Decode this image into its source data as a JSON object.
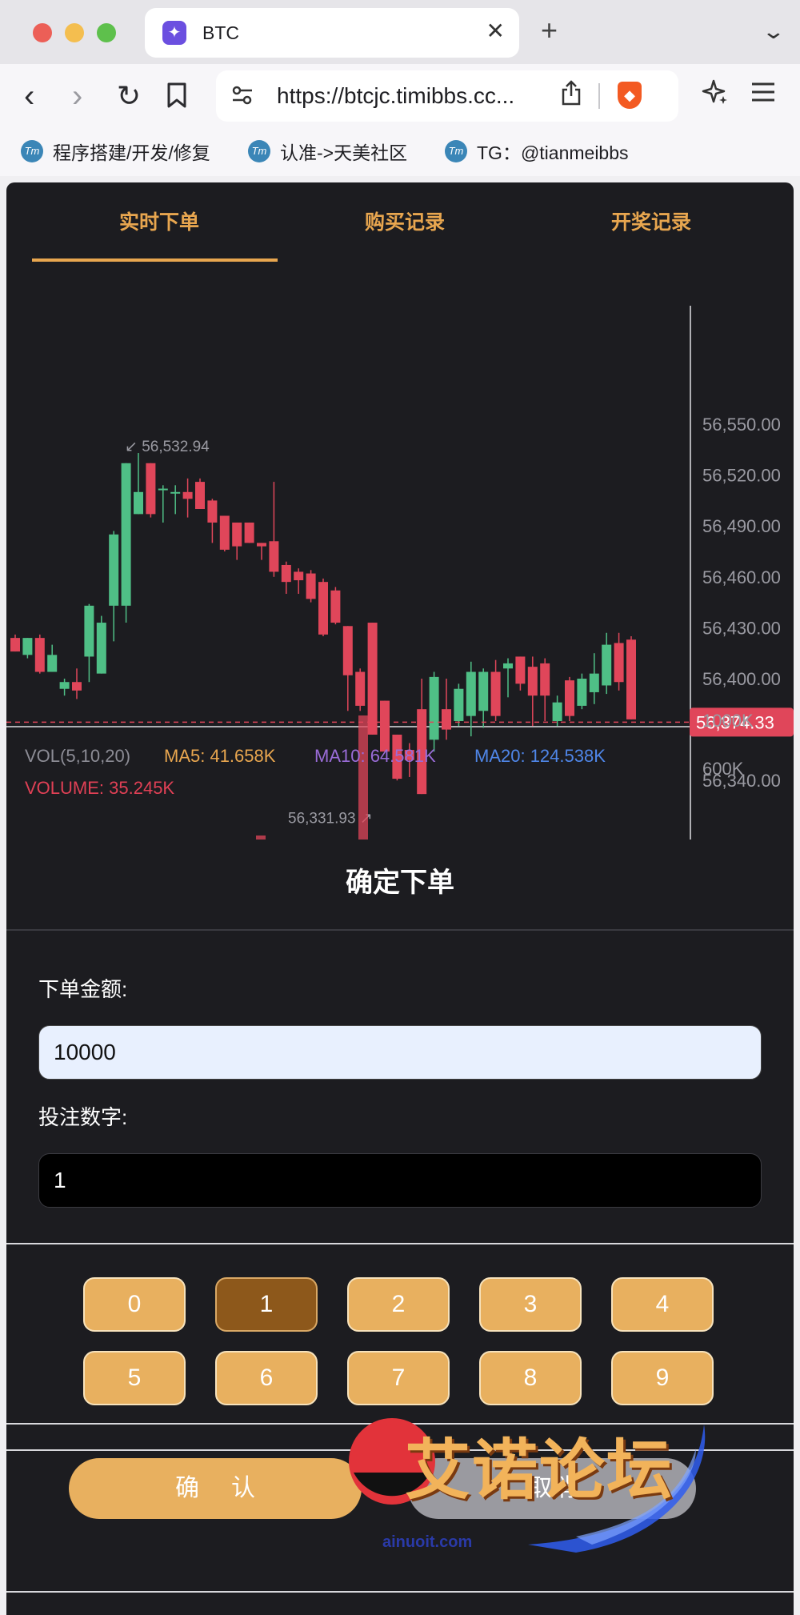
{
  "browser": {
    "tab_title": "BTC",
    "tab_close": "✕",
    "new_tab": "+",
    "tab_menu": "⌄",
    "back_icon": "‹",
    "forward_icon": "›",
    "reload_icon": "↻",
    "url": "https://btcjc.timibbs.cc...",
    "bookmarks": [
      {
        "label": "程序搭建/开发/修复",
        "icon_text": "Tm"
      },
      {
        "label": "认准->天美社区",
        "icon_text": "Tm"
      },
      {
        "label": "TG：@tianmeibbs",
        "icon_text": "Tm"
      }
    ]
  },
  "app": {
    "tabs": [
      {
        "label": "实时下单",
        "active": true
      },
      {
        "label": "购买记录",
        "active": false
      },
      {
        "label": "开奖记录",
        "active": false
      }
    ],
    "accent_color": "#e8a64f",
    "up_color": "#4fbf86",
    "down_color": "#e0465a"
  },
  "chart": {
    "price_axis": [
      "56,550.00",
      "56,520.00",
      "56,490.00",
      "56,460.00",
      "56,430.00",
      "56,400.00",
      "56,340.00"
    ],
    "current_price": "56,374.33",
    "high_label": "56,532.94",
    "low_label": "56,331.93",
    "volume_axis": [
      "1000K",
      "600K"
    ],
    "vol_legend": {
      "vol": "VOL(5,10,20)",
      "ma5": "MA5: 41.658K",
      "ma10": "MA10: 64.581K",
      "ma20": "MA20: 124.538K",
      "volume": "VOLUME: 35.245K"
    },
    "candles": [
      {
        "o": 56424,
        "h": 56426,
        "l": 56416,
        "c": 56416
      },
      {
        "o": 56414,
        "h": 56424,
        "l": 56412,
        "c": 56424
      },
      {
        "o": 56424,
        "h": 56426,
        "l": 56403,
        "c": 56404
      },
      {
        "o": 56404,
        "h": 56420,
        "l": 56404,
        "c": 56414
      },
      {
        "o": 56394,
        "h": 56400,
        "l": 56390,
        "c": 56398
      },
      {
        "o": 56398,
        "h": 56406,
        "l": 56388,
        "c": 56393
      },
      {
        "o": 56413,
        "h": 56444,
        "l": 56398,
        "c": 56443
      },
      {
        "o": 56403,
        "h": 56437,
        "l": 56403,
        "c": 56433
      },
      {
        "o": 56443,
        "h": 56487,
        "l": 56422,
        "c": 56485
      },
      {
        "o": 56443,
        "h": 56511,
        "l": 56433,
        "c": 56527
      },
      {
        "o": 56497,
        "h": 56533,
        "l": 56497,
        "c": 56510
      },
      {
        "o": 56527,
        "h": 56527,
        "l": 56495,
        "c": 56497
      },
      {
        "o": 56512,
        "h": 56514,
        "l": 56492,
        "c": 56512
      },
      {
        "o": 56510,
        "h": 56514,
        "l": 56497,
        "c": 56510
      },
      {
        "o": 56510,
        "h": 56518,
        "l": 56495,
        "c": 56506
      },
      {
        "o": 56516,
        "h": 56518,
        "l": 56500,
        "c": 56500
      },
      {
        "o": 56505,
        "h": 56506,
        "l": 56480,
        "c": 56492
      },
      {
        "o": 56496,
        "h": 56496,
        "l": 56475,
        "c": 56476
      },
      {
        "o": 56492,
        "h": 56492,
        "l": 56470,
        "c": 56478
      },
      {
        "o": 56492,
        "h": 56492,
        "l": 56480,
        "c": 56480
      },
      {
        "o": 56480,
        "h": 56480,
        "l": 56470,
        "c": 56478
      },
      {
        "o": 56481,
        "h": 56516,
        "l": 56460,
        "c": 56463
      },
      {
        "o": 56467,
        "h": 56469,
        "l": 56450,
        "c": 56457
      },
      {
        "o": 56463,
        "h": 56465,
        "l": 56450,
        "c": 56458
      },
      {
        "o": 56462,
        "h": 56464,
        "l": 56445,
        "c": 56447
      },
      {
        "o": 56457,
        "h": 56459,
        "l": 56425,
        "c": 56426
      },
      {
        "o": 56452,
        "h": 56454,
        "l": 56432,
        "c": 56433
      },
      {
        "o": 56431,
        "h": 56431,
        "l": 56381,
        "c": 56402
      },
      {
        "o": 56404,
        "h": 56406,
        "l": 56381,
        "c": 56384
      },
      {
        "o": 56433,
        "h": 56433,
        "l": 56367,
        "c": 56367
      },
      {
        "o": 56387,
        "h": 56387,
        "l": 56357,
        "c": 56357
      },
      {
        "o": 56367,
        "h": 56367,
        "l": 56340,
        "c": 56341
      },
      {
        "o": 56358,
        "h": 56362,
        "l": 56342,
        "c": 56352
      },
      {
        "o": 56382,
        "h": 56400,
        "l": 56332,
        "c": 56332
      },
      {
        "o": 56364,
        "h": 56404,
        "l": 56357,
        "c": 56401
      },
      {
        "o": 56382,
        "h": 56400,
        "l": 56364,
        "c": 56370
      },
      {
        "o": 56375,
        "h": 56397,
        "l": 56372,
        "c": 56394
      },
      {
        "o": 56378,
        "h": 56410,
        "l": 56366,
        "c": 56404
      },
      {
        "o": 56381,
        "h": 56406,
        "l": 56371,
        "c": 56404
      },
      {
        "o": 56404,
        "h": 56411,
        "l": 56375,
        "c": 56378
      },
      {
        "o": 56406,
        "h": 56412,
        "l": 56389,
        "c": 56409
      },
      {
        "o": 56413,
        "h": 56413,
        "l": 56393,
        "c": 56397
      },
      {
        "o": 56407,
        "h": 56413,
        "l": 56372,
        "c": 56390
      },
      {
        "o": 56409,
        "h": 56412,
        "l": 56375,
        "c": 56390
      },
      {
        "o": 56375,
        "h": 56390,
        "l": 56372,
        "c": 56386
      },
      {
        "o": 56399,
        "h": 56401,
        "l": 56375,
        "c": 56378
      },
      {
        "o": 56384,
        "h": 56403,
        "l": 56382,
        "c": 56400
      },
      {
        "o": 56392,
        "h": 56415,
        "l": 56385,
        "c": 56403
      },
      {
        "o": 56396,
        "h": 56427,
        "l": 56391,
        "c": 56420
      },
      {
        "o": 56421,
        "h": 56427,
        "l": 56393,
        "c": 56398
      },
      {
        "o": 56423,
        "h": 56425,
        "l": 56385,
        "c": 56376
      }
    ],
    "volume_bars": [
      {
        "value": 1040,
        "direction": "down"
      },
      {
        "value": 40,
        "direction": "down"
      }
    ]
  },
  "order": {
    "title": "确定下单",
    "amount_label": "下单金额:",
    "amount_value": "10000",
    "number_label": "投注数字:",
    "number_value": "1",
    "digits": [
      "0",
      "1",
      "2",
      "3",
      "4",
      "5",
      "6",
      "7",
      "8",
      "9"
    ],
    "selected_digit": "1",
    "confirm_label": "确认",
    "cancel_label": "取消"
  },
  "watermark": {
    "text": "艾诺论坛",
    "sub": "ainuoit.com"
  }
}
